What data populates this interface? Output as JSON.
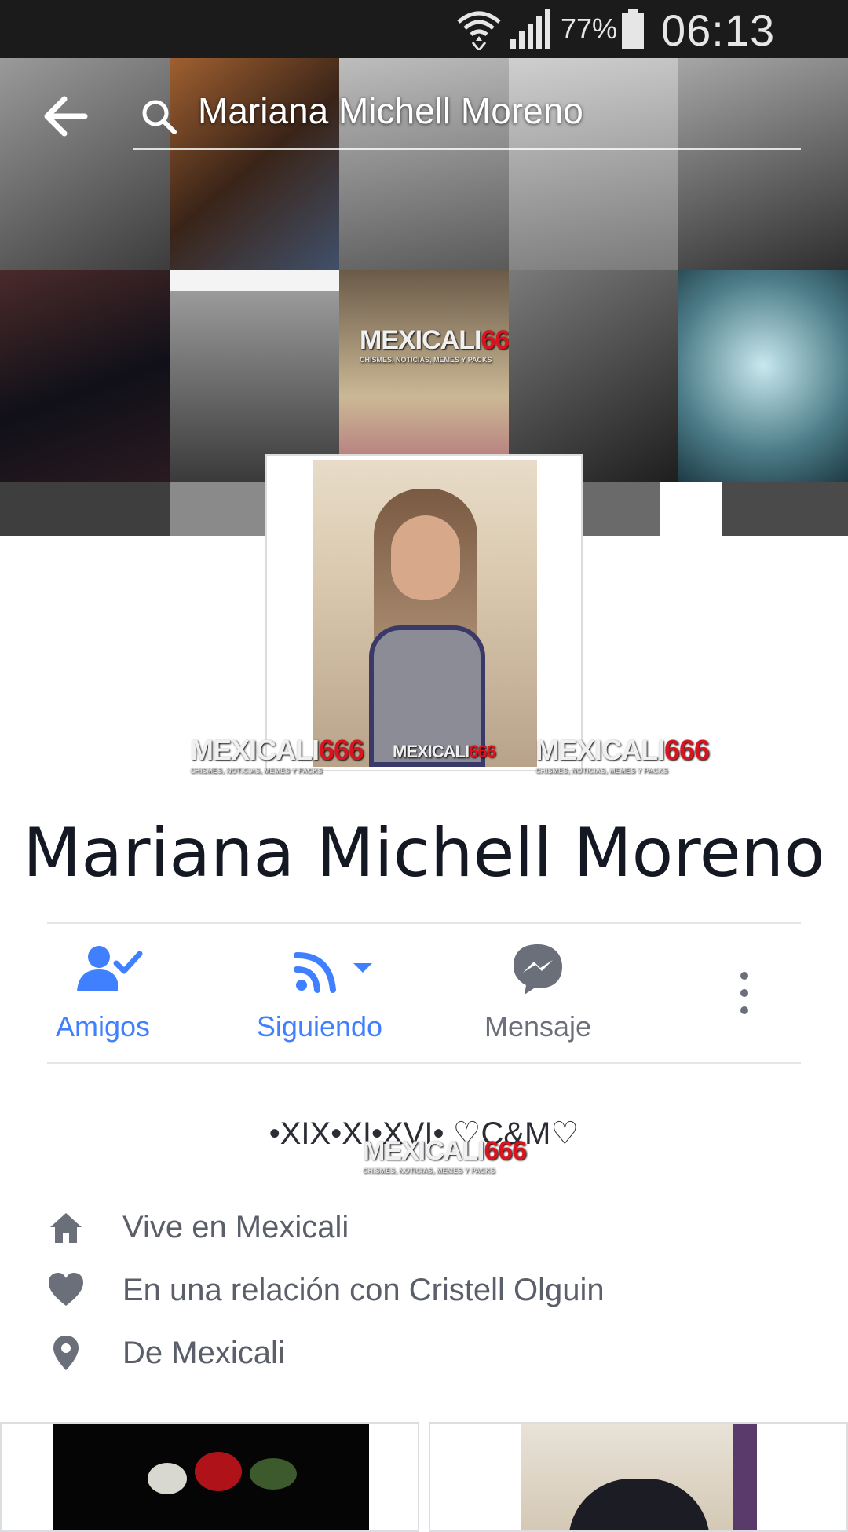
{
  "status_bar": {
    "battery": "77%",
    "time": "06:13 PM"
  },
  "search": {
    "query": "Mariana Michell Moreno"
  },
  "watermark": {
    "brand_white": "MEXICALI",
    "brand_red": "666",
    "tagline": "CHISMES, NOTICIAS, MEMES Y PACKS"
  },
  "profile": {
    "name": "Mariana Michell Moreno",
    "bio": "•XIX•XI•XVI•  ♡C&M♡"
  },
  "actions": {
    "friends": "Amigos",
    "following": "Siguiendo",
    "message": "Mensaje"
  },
  "info": [
    {
      "icon": "home-icon",
      "text": "Vive en Mexicali"
    },
    {
      "icon": "heart-icon",
      "text": "En una relación con Cristell Olguin"
    },
    {
      "icon": "location-pin-icon",
      "text": "De Mexicali"
    }
  ],
  "colors": {
    "accent_blue": "#4080ff",
    "muted_grey": "#6a6f7a",
    "status_bar": "#1b1b1b",
    "watermark_red": "#d8141e"
  }
}
